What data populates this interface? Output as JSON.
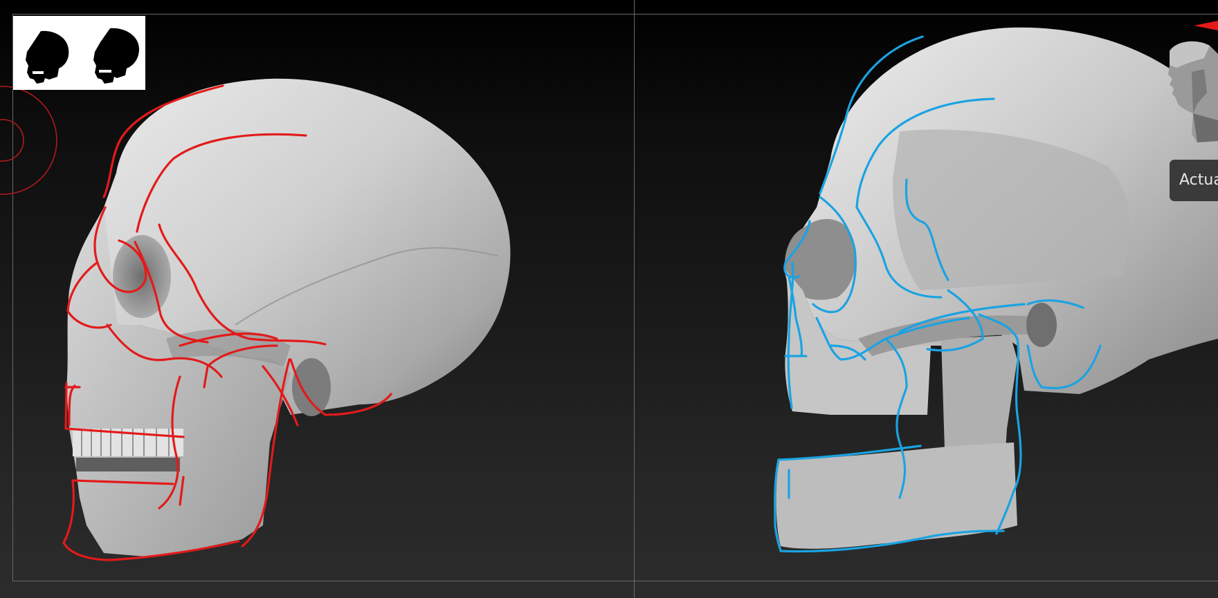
{
  "viewport": {
    "camera_button_label": "Actua"
  },
  "colors": {
    "background_top": "#000000",
    "background_bottom": "#2c2c2c",
    "frame_line": "#6a6a6a",
    "overlay_left": "#e31a1a",
    "overlay_right": "#1aa3e3",
    "skull_light": "#d8d8d8",
    "skull_shadow": "#6a6a6a"
  },
  "icons": {
    "reference_thumbnail": "skull-silhouettes-icon",
    "navigation_gizmo": "head-gizmo-icon",
    "rotate_indicator": "rotate-indicator-icon"
  }
}
